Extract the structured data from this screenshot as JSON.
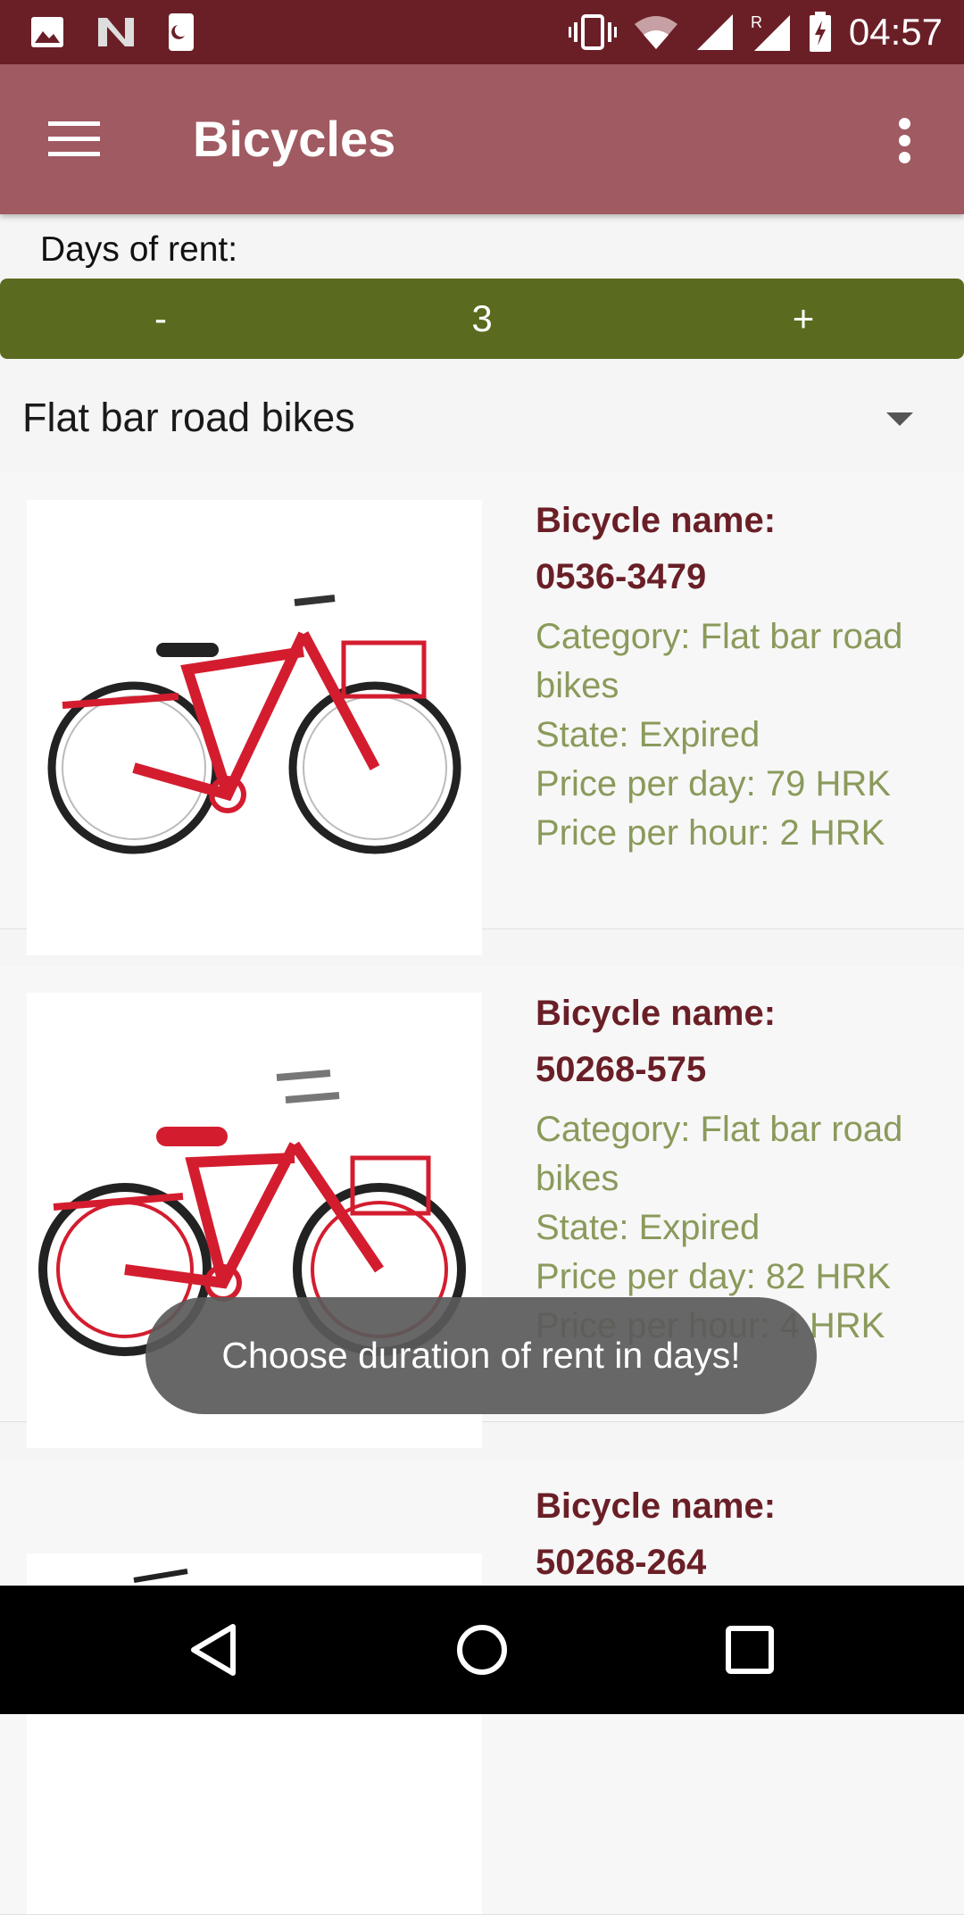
{
  "status_bar": {
    "time": "04:57",
    "left_icons": [
      "image-icon",
      "n-logo-icon",
      "sim-card-icon"
    ],
    "right_icons": [
      "vibrate-icon",
      "wifi-icon",
      "signal-icon",
      "roaming-signal-icon",
      "battery-charging-icon"
    ],
    "background": "#6a1f27"
  },
  "app_bar": {
    "title": "Bicycles",
    "menu_icon": "hamburger-menu-icon",
    "overflow_icon": "more-vert-icon",
    "background": "#a05a62"
  },
  "rent": {
    "label": "Days of rent:",
    "minus_label": "-",
    "value": "3",
    "plus_label": "+",
    "background": "#5a6b1f"
  },
  "category_select": {
    "selected": "Flat bar road bikes",
    "arrow_icon": "dropdown-arrow-icon"
  },
  "bikes": [
    {
      "name_label": "Bicycle name:",
      "name": "0536-3479",
      "category": "Category: Flat bar road bikes",
      "state": "State: Expired",
      "price_day": "Price per day: 79 HRK",
      "price_hour": "Price per hour: 2 HRK",
      "image_icon": "red-bicycle-basket-image"
    },
    {
      "name_label": "Bicycle name:",
      "name": "50268-575",
      "category": "Category: Flat bar road bikes",
      "state": "State: Expired",
      "price_day": "Price per day: 82 HRK",
      "price_hour": "Price per hour: 4 HRK",
      "image_icon": "red-bicycle-basket-image"
    },
    {
      "name_label": "Bicycle name:",
      "name": "50268-264",
      "image_icon": "bicycle-image"
    }
  ],
  "toast": {
    "message": "Choose duration of rent in days!"
  },
  "nav_bar": {
    "back_icon": "back-triangle-icon",
    "home_icon": "home-circle-icon",
    "recents_icon": "recents-square-icon"
  },
  "colors": {
    "name_text": "#6a1f27",
    "meta_text": "#8a9a5b"
  }
}
